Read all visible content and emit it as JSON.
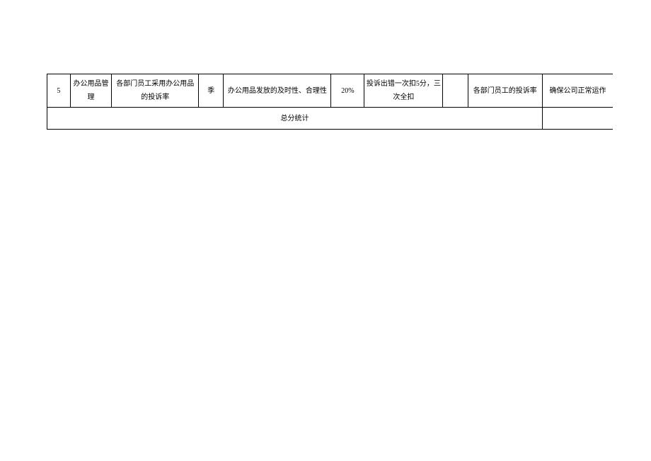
{
  "row": {
    "num": "5",
    "name": "办公用品管理",
    "desc": "各部门员工采用办公用品的投诉率",
    "period": "季",
    "content": "办公用品发放的及时性、合理性",
    "weight": "20%",
    "scoring": "投诉出错一次扣5分，三次全扣",
    "score": "",
    "source": "各部门员工的投诉率",
    "goal": "确保公司正常运作"
  },
  "summary": {
    "label": "总分统计",
    "value": ""
  }
}
